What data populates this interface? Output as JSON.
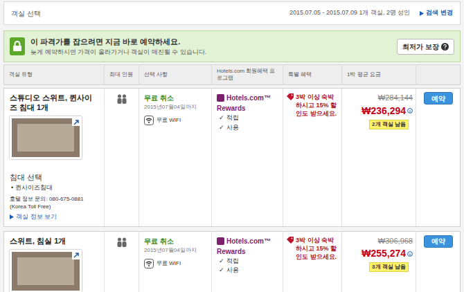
{
  "header": {
    "title": "객실 선택",
    "dates": "2015.07.05 - 2015.07.09 1개 객실, 2명 성인",
    "change_link": "검색 변경"
  },
  "banner": {
    "title": "이 파격가를 잡으려면 지금 바로 예약하세요.",
    "subtitle": "늦게 예약하시면 가격이 올라가거나 객실이 매진될 수 있습니다.",
    "guarantee": "최저가 보장"
  },
  "table": {
    "columns": [
      "객실 유형",
      "최대 인원",
      "선택 사항",
      "Hotels.com 회원혜택 프로그램",
      "특별 혜택",
      "1박 평균 요금"
    ],
    "rows": [
      {
        "name": "스튜디오 스위트, 퀸사이즈 침대 1개",
        "bed_title": "침대 선택",
        "bed": "• 퀸사이즈침대",
        "phone": "호텔 정보 문의: 080-675-0881",
        "phone_note": "(Korea Toll Free)",
        "info_link": "객실 정보 보기",
        "cancel": "무료 취소",
        "cancel_until": "2015년07월04일까지",
        "wifi": "무료 WIFI",
        "rewards_brand": "Hotels.com™",
        "rewards_sub": "Rewards",
        "earn": "✓ 적립",
        "use": "✓ 사용",
        "deal": "3박 이상 숙박하시고 15% 할인도 받으세요.",
        "original_price": "₩284,144",
        "price": "₩236,294",
        "remaining": "2개 객실 남음",
        "button": "예약"
      },
      {
        "name": "스위트, 침실 1개",
        "bed_title": "",
        "bed": "",
        "phone": "",
        "phone_note": "",
        "info_link": "",
        "cancel": "무료 취소",
        "cancel_until": "2015년07월04일까지",
        "wifi": "무료 WIFI",
        "rewards_brand": "Hotels.com™",
        "rewards_sub": "Rewards",
        "earn": "✓ 적립",
        "use": "✓ 사용",
        "deal": "3박 이상 숙박하시고 15% 할인도 받으세요.",
        "original_price": "₩306,968",
        "price": "₩255,274",
        "remaining": "3개 객실 남음",
        "button": "예약"
      }
    ]
  }
}
